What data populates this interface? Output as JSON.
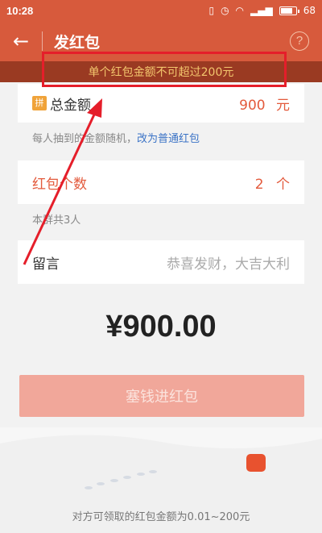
{
  "status": {
    "time": "10:28",
    "battery": "68"
  },
  "header": {
    "title": "发红包",
    "back_symbol": "←",
    "help_symbol": "?"
  },
  "warning": {
    "text": "单个红包金额不可超过200元"
  },
  "total": {
    "label": "总金额",
    "icon_char": "拼",
    "value": "900",
    "unit": "元"
  },
  "total_hint": {
    "text": "每人抽到的金额随机，",
    "link": "改为普通红包"
  },
  "count": {
    "label": "红包个数",
    "value": "2",
    "unit": "个"
  },
  "count_hint": {
    "text": "本群共3人"
  },
  "message": {
    "label": "留言",
    "placeholder": "恭喜发财，大吉大利"
  },
  "amount": {
    "display": "¥900.00"
  },
  "submit": {
    "label": "塞钱进红包"
  },
  "footer": {
    "text": "对方可领取的红包金额为0.01~200元"
  },
  "colors": {
    "header": "#d75a3c",
    "warning_bg": "#9a3a22",
    "warning_text": "#f3c66d",
    "accent": "#e35a3c",
    "annotation": "#e51e2a"
  }
}
